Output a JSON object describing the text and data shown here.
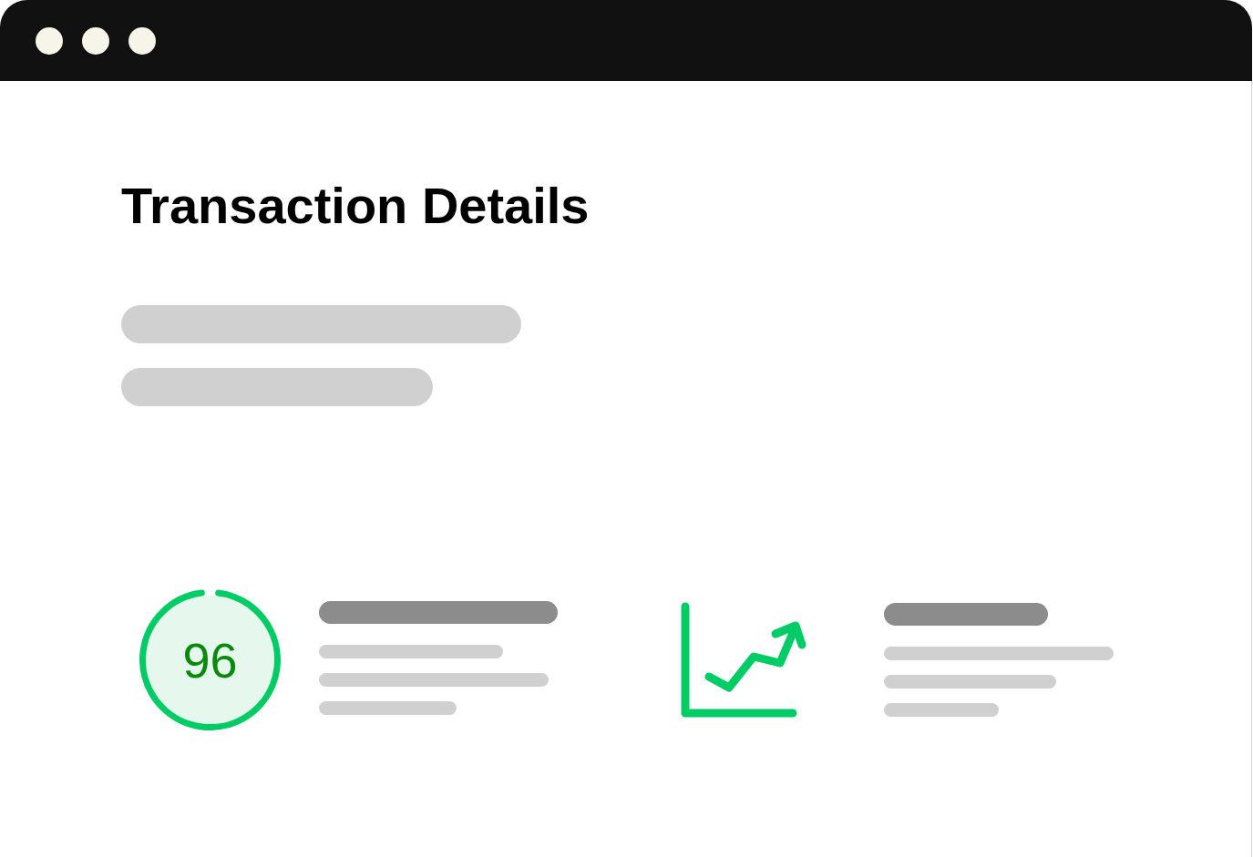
{
  "page": {
    "title": "Transaction Details",
    "placeholder_lines": [
      {
        "kind": "large"
      },
      {
        "kind": "large"
      }
    ]
  },
  "cards": [
    {
      "kind": "score",
      "score": "96",
      "level": 0.96,
      "placeholder_lines": [
        {
          "kind": "heading"
        },
        {
          "kind": "text"
        },
        {
          "kind": "text"
        },
        {
          "kind": "text"
        }
      ]
    },
    {
      "kind": "trend",
      "placeholder_lines": [
        {
          "kind": "heading"
        },
        {
          "kind": "text"
        },
        {
          "kind": "text"
        },
        {
          "kind": "text"
        }
      ]
    }
  ]
}
